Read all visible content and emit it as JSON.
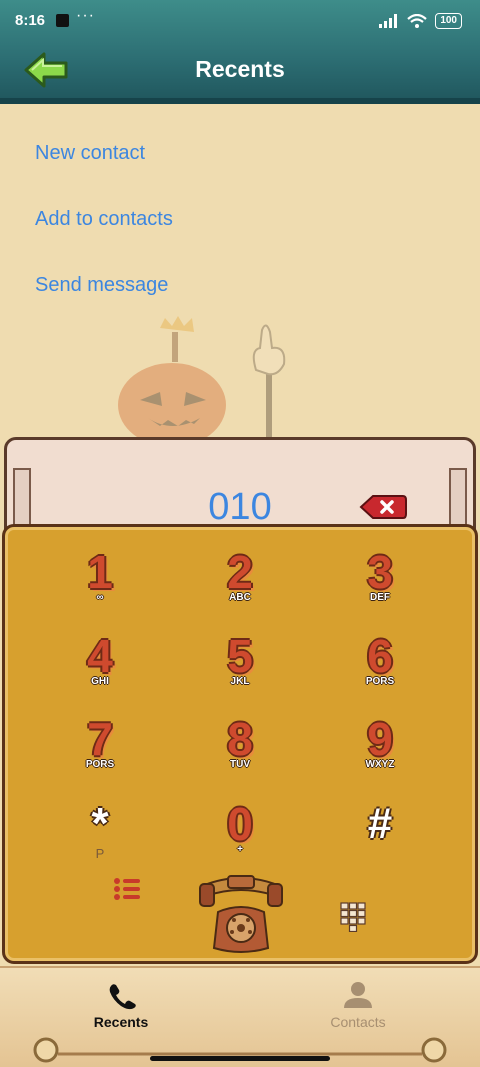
{
  "status_bar": {
    "time": "8:16",
    "dots": "···",
    "battery": "100"
  },
  "header": {
    "title": "Recents"
  },
  "menu": {
    "new_contact": "New contact",
    "add_to_contacts": "Add to contacts",
    "send_message": "Send message"
  },
  "display": {
    "number": "010"
  },
  "keypad": {
    "keys": [
      {
        "digit": "1",
        "sub": "∞"
      },
      {
        "digit": "2",
        "sub": "ABC"
      },
      {
        "digit": "3",
        "sub": "DEF"
      },
      {
        "digit": "4",
        "sub": "GHI"
      },
      {
        "digit": "5",
        "sub": "JKL"
      },
      {
        "digit": "6",
        "sub": "PORS"
      },
      {
        "digit": "7",
        "sub": "PORS"
      },
      {
        "digit": "8",
        "sub": "TUV"
      },
      {
        "digit": "9",
        "sub": "WXYZ"
      },
      {
        "digit": "*",
        "sub": "P"
      },
      {
        "digit": "0",
        "sub": "+"
      },
      {
        "digit": "#",
        "sub": ""
      }
    ]
  },
  "bottom_nav": {
    "recents": "Recents",
    "contacts": "Contacts"
  },
  "colors": {
    "header": "#2d6f74",
    "link": "#3c86e0",
    "keypad": "#d7a02e",
    "digit": "#cf4a2e"
  }
}
